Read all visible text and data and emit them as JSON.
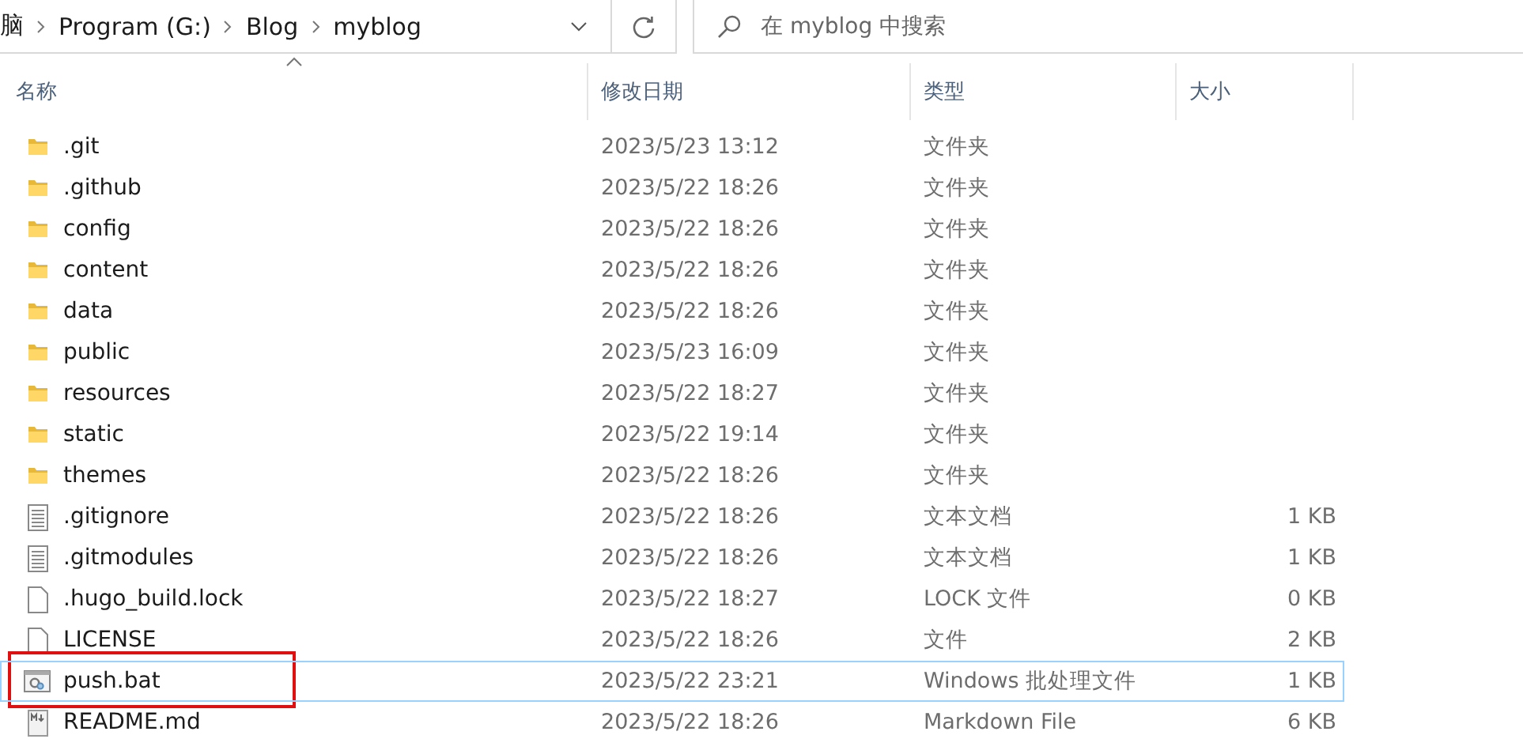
{
  "address_bar": {
    "crumbs": [
      "脑",
      "Program (G:)",
      "Blog",
      "myblog"
    ]
  },
  "search": {
    "placeholder": "在 myblog 中搜索"
  },
  "columns": [
    {
      "label": "名称",
      "sorted": true
    },
    {
      "label": "修改日期",
      "sorted": false
    },
    {
      "label": "类型",
      "sorted": false
    },
    {
      "label": "大小",
      "sorted": false
    }
  ],
  "rows": [
    {
      "kind": "folder",
      "name": ".git",
      "date": "2023/5/23 13:12",
      "type": "文件夹",
      "selected": false,
      "highlighted": false
    },
    {
      "kind": "folder",
      "name": ".github",
      "date": "2023/5/22 18:26",
      "type": "文件夹",
      "selected": false,
      "highlighted": false
    },
    {
      "kind": "folder",
      "name": "config",
      "date": "2023/5/22 18:26",
      "type": "文件夹",
      "selected": false,
      "highlighted": false
    },
    {
      "kind": "folder",
      "name": "content",
      "date": "2023/5/22 18:26",
      "type": "文件夹",
      "selected": false,
      "highlighted": false
    },
    {
      "kind": "folder",
      "name": "data",
      "date": "2023/5/22 18:26",
      "type": "文件夹",
      "selected": false,
      "highlighted": false
    },
    {
      "kind": "folder",
      "name": "public",
      "date": "2023/5/23 16:09",
      "type": "文件夹",
      "selected": false,
      "highlighted": false
    },
    {
      "kind": "folder",
      "name": "resources",
      "date": "2023/5/22 18:27",
      "type": "文件夹",
      "selected": false,
      "highlighted": false
    },
    {
      "kind": "folder",
      "name": "static",
      "date": "2023/5/22 19:14",
      "type": "文件夹",
      "selected": false,
      "highlighted": false
    },
    {
      "kind": "folder",
      "name": "themes",
      "date": "2023/5/22 18:26",
      "type": "文件夹",
      "selected": false,
      "highlighted": false
    },
    {
      "kind": "text",
      "name": ".gitignore",
      "date": "2023/5/22 18:26",
      "type": "文本文档",
      "size": "1 KB",
      "selected": false,
      "highlighted": false
    },
    {
      "kind": "text",
      "name": ".gitmodules",
      "date": "2023/5/22 18:26",
      "type": "文本文档",
      "size": "1 KB",
      "selected": false,
      "highlighted": false
    },
    {
      "kind": "blank",
      "name": ".hugo_build.lock",
      "date": "2023/5/22 18:27",
      "type": "LOCK 文件",
      "size": "0 KB",
      "selected": false,
      "highlighted": false
    },
    {
      "kind": "blank",
      "name": "LICENSE",
      "date": "2023/5/22 18:26",
      "type": "文件",
      "size": "2 KB",
      "selected": false,
      "highlighted": false
    },
    {
      "kind": "batch",
      "name": "push.bat",
      "date": "2023/5/22 23:21",
      "type": "Windows 批处理文件",
      "size": "1 KB",
      "selected": true,
      "highlighted": true
    },
    {
      "kind": "markdown",
      "name": "README.md",
      "date": "2023/5/22 18:26",
      "type": "Markdown File",
      "size": "6 KB",
      "selected": false,
      "highlighted": false
    }
  ]
}
